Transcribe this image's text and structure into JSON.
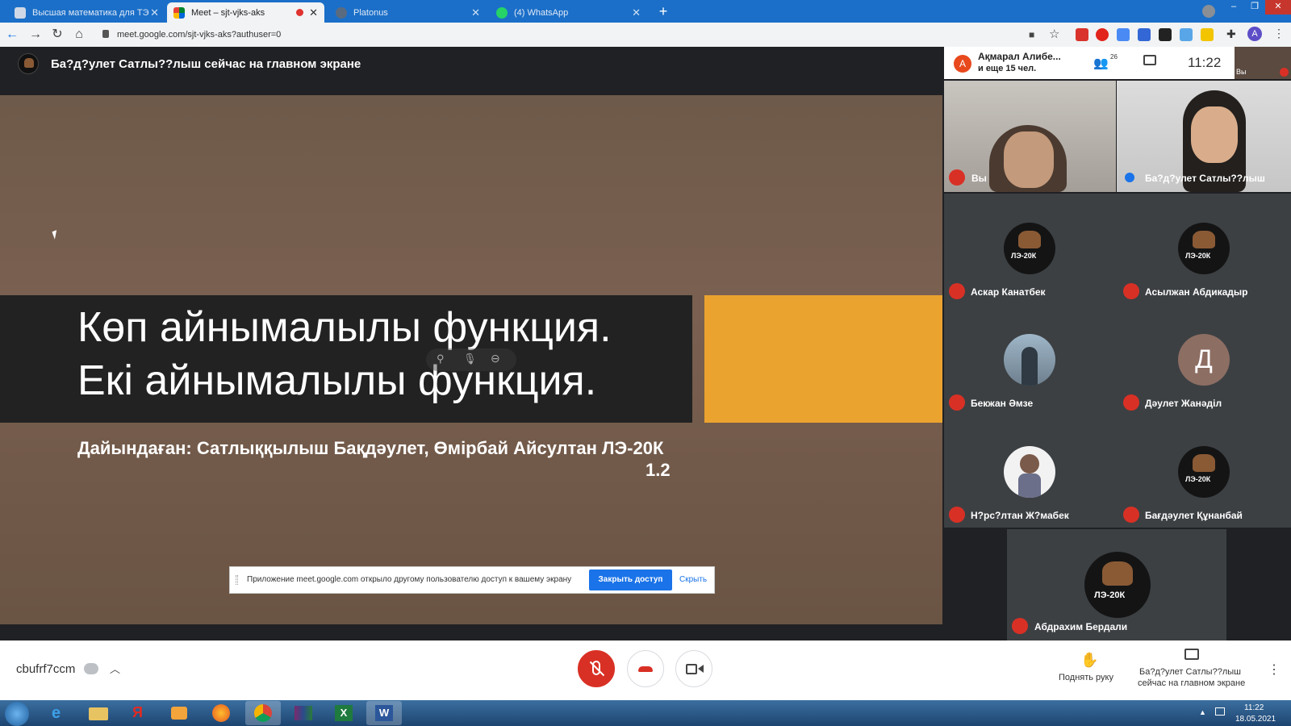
{
  "browser": {
    "tabs": [
      {
        "title": "Высшая математика для ТЭ",
        "active": false
      },
      {
        "title": "Meet – sjt-vjks-aks",
        "active": true
      },
      {
        "title": "Platonus",
        "active": false
      },
      {
        "title": "(4) WhatsApp",
        "active": false
      }
    ],
    "url": "meet.google.com/sjt-vjks-aks?authuser=0",
    "profile_initial": "A"
  },
  "meet": {
    "presenter_banner": "Ба?д?улет Сатлы??лыш сейчас на главном экране",
    "participants_chip": {
      "initial": "А",
      "line1": "Ақмарал Алибе...",
      "line2": "и еще 15 чел."
    },
    "people_count": "26",
    "clock": "11:22",
    "self_thumb_label": "Вы",
    "meeting_code": "cbufrf7ccm",
    "raise_hand_label": "Поднять руку",
    "present_label_line1": "Ба?д?улет Сатлы??лыш",
    "present_label_line2": "сейчас на главном экране"
  },
  "slide": {
    "title_line1": "Көп айнымалылы функция.",
    "title_line2": "Екі  айнымалылы функция.",
    "subtitle_line1": "Дайындаған: Сатлыққылыш Бақдәулет, Өмірбай Айсултан ЛЭ-20К",
    "subtitle_line2": "1.2"
  },
  "share_notice": {
    "text": "Приложение meet.google.com открыло другому пользователю доступ к вашему экрану",
    "stop_button": "Закрыть доступ",
    "hide_link": "Скрыть"
  },
  "participants": [
    {
      "name": "Вы",
      "type": "video"
    },
    {
      "name": "Ба?д?улет Сатлы??лыш",
      "type": "video"
    },
    {
      "name": "Аскар Канатбек",
      "type": "logo"
    },
    {
      "name": "Асылжан Абдикадыр",
      "type": "logo"
    },
    {
      "name": "Бекжан Әмзе",
      "type": "photo"
    },
    {
      "name": "Дәулет Жанәділ",
      "type": "initial",
      "initial": "Д"
    },
    {
      "name": "Н?рс?лтан Ж?мабек",
      "type": "cartoon"
    },
    {
      "name": "Бағдәулет Құнанбай",
      "type": "logo"
    },
    {
      "name": "Абдрахим Бердали",
      "type": "logo"
    }
  ],
  "logo_text": "ЛЭ-20К",
  "taskbar": {
    "time": "11:22",
    "date": "18.05.2021"
  },
  "colors": {
    "tabstrip": "#1b6fc8",
    "meet_bg": "#202124",
    "hangup": "#d93025",
    "accent_blue": "#1a73e8",
    "slide_orange": "#eba32f"
  }
}
